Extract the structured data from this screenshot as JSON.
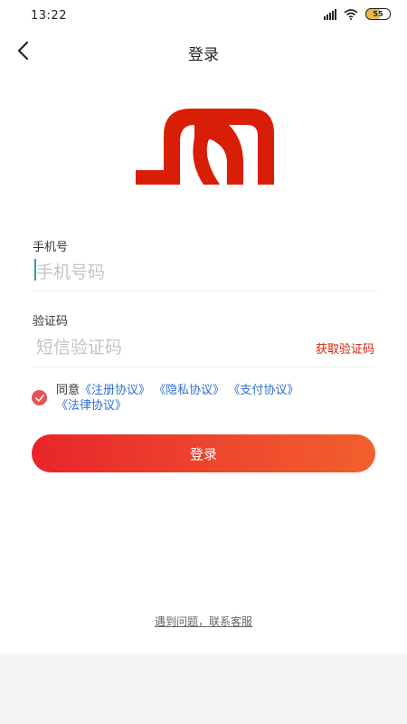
{
  "status_bar": {
    "time": "13:22",
    "battery": "55"
  },
  "header": {
    "title": "登录"
  },
  "phone": {
    "label": "手机号",
    "placeholder": "手机号码",
    "value": ""
  },
  "code": {
    "label": "验证码",
    "placeholder": "短信验证码",
    "value": "",
    "get_code_label": "获取验证码"
  },
  "agreement": {
    "checked": true,
    "prefix": "同意",
    "links": [
      "《注册协议》",
      "《隐私协议》",
      "《支付协议》",
      "《法律协议》"
    ]
  },
  "login_button": {
    "label": "登录"
  },
  "help": {
    "label": "遇到问题，联系客服"
  },
  "colors": {
    "brand_red": "#d81e06",
    "link_blue": "#2f6fd1",
    "button_gradient_start": "#e8252a",
    "button_gradient_end": "#f2602c",
    "checkbox": "#e85252"
  }
}
